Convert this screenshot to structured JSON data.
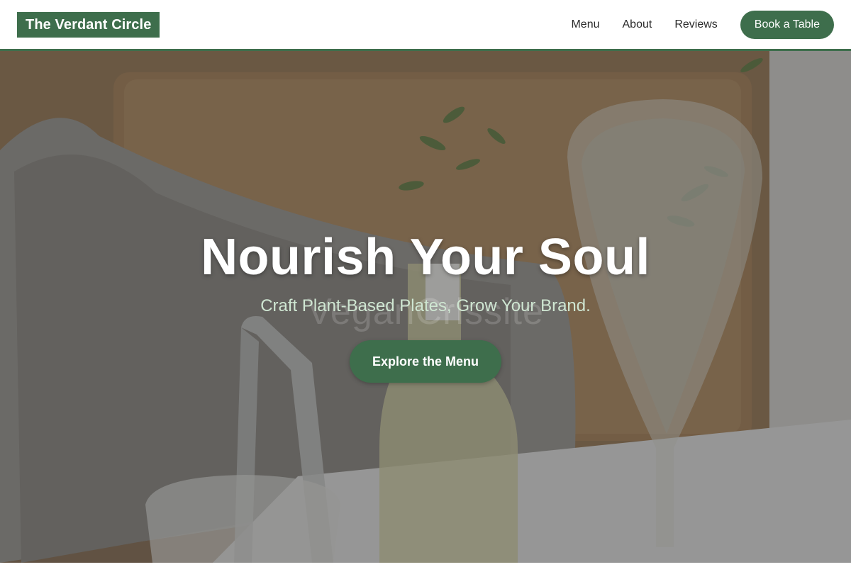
{
  "header": {
    "logo_text": "The Verdant Circle",
    "nav": [
      {
        "label": "Menu"
      },
      {
        "label": "About"
      },
      {
        "label": "Reviews"
      }
    ],
    "cta_label": "Book a Table"
  },
  "hero": {
    "title": "Nourish Your Soul",
    "subtitle": "Craft Plant-Based Plates, Grow Your Brand.",
    "watermark": "VeganCrissite",
    "cta_label": "Explore the Menu",
    "photo_subject": "restaurant-table-glassware-photo"
  },
  "colors": {
    "brand_green": "#3e6e4c",
    "subtitle_green": "#cfe6d2",
    "header_bg": "#ffffff",
    "nav_text": "#2a2a2a"
  }
}
